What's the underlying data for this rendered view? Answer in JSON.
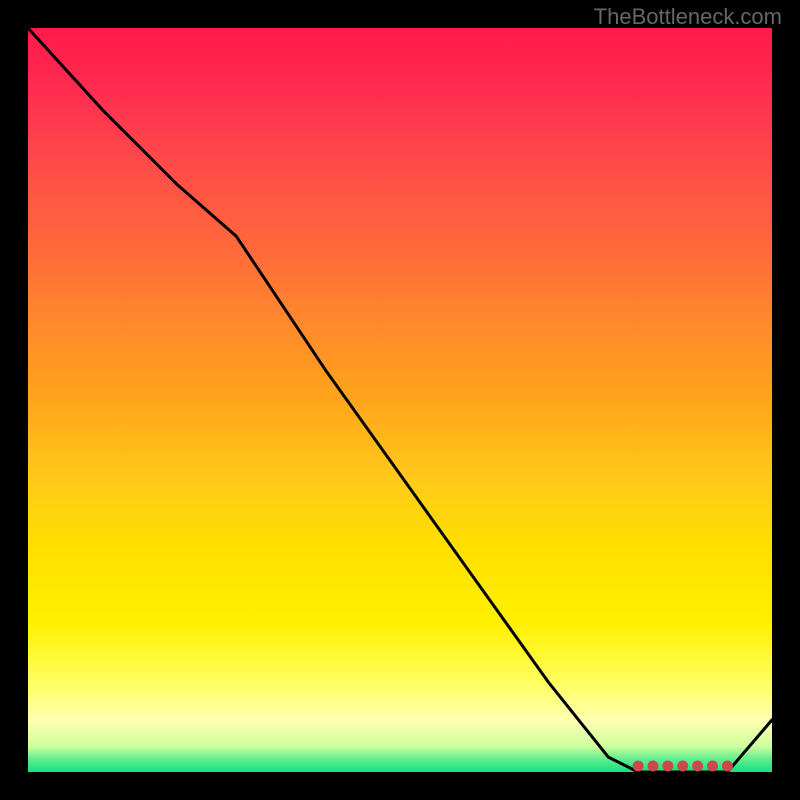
{
  "watermark": "TheBottleneck.com",
  "chart_data": {
    "type": "line",
    "title": "",
    "xlabel": "",
    "ylabel": "",
    "xlim": [
      0,
      100
    ],
    "ylim": [
      0,
      100
    ],
    "grid": false,
    "legend": false,
    "series": [
      {
        "name": "bottleneck-curve",
        "x": [
          0,
          10,
          20,
          28,
          40,
          50,
          60,
          70,
          78,
          82,
          86,
          90,
          94,
          100
        ],
        "y": [
          100,
          89,
          79,
          72,
          54,
          40,
          26,
          12,
          2,
          0,
          0,
          0,
          0,
          7
        ],
        "color": "#000000"
      }
    ],
    "markers": [
      {
        "x": 82,
        "y": 0.8,
        "color": "#c94a4a"
      },
      {
        "x": 84,
        "y": 0.8,
        "color": "#c94a4a"
      },
      {
        "x": 86,
        "y": 0.8,
        "color": "#c94a4a"
      },
      {
        "x": 88,
        "y": 0.8,
        "color": "#c94a4a"
      },
      {
        "x": 90,
        "y": 0.8,
        "color": "#c94a4a"
      },
      {
        "x": 92,
        "y": 0.8,
        "color": "#c94a4a"
      },
      {
        "x": 94,
        "y": 0.8,
        "color": "#c94a4a"
      }
    ],
    "gradient_stops": [
      {
        "pos": 0,
        "color": "#ff1a4a"
      },
      {
        "pos": 50,
        "color": "#ffa51a"
      },
      {
        "pos": 80,
        "color": "#fff000"
      },
      {
        "pos": 100,
        "color": "#10e080"
      }
    ]
  }
}
